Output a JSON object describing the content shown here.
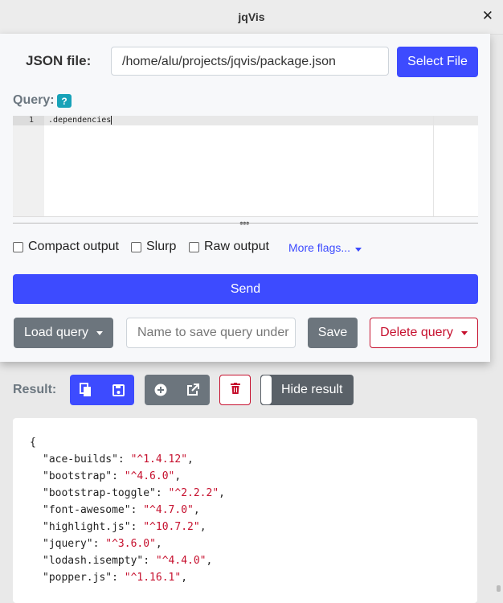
{
  "window": {
    "title": "jqVis"
  },
  "file": {
    "label": "JSON file:",
    "path": "/home/alu/projects/jqvis/package.json",
    "select_label": "Select File"
  },
  "query": {
    "label": "Query:",
    "help": "?",
    "line_number": "1",
    "code": ".dependencies"
  },
  "options": {
    "compact": "Compact output",
    "slurp": "Slurp",
    "raw": "Raw output",
    "more_flags": "More flags..."
  },
  "actions": {
    "send": "Send",
    "load_query": "Load query",
    "name_placeholder": "Name to save query under",
    "save": "Save",
    "delete_query": "Delete query"
  },
  "result": {
    "label": "Result:",
    "toggle_label": "Hide result",
    "open_brace": "{",
    "entries": [
      {
        "key": "\"ace-builds\"",
        "value": "\"^1.4.12\""
      },
      {
        "key": "\"bootstrap\"",
        "value": "\"^4.6.0\""
      },
      {
        "key": "\"bootstrap-toggle\"",
        "value": "\"^2.2.2\""
      },
      {
        "key": "\"font-awesome\"",
        "value": "\"^4.7.0\""
      },
      {
        "key": "\"highlight.js\"",
        "value": "\"^10.7.2\""
      },
      {
        "key": "\"jquery\"",
        "value": "\"^3.6.0\""
      },
      {
        "key": "\"lodash.isempty\"",
        "value": "\"^4.4.0\""
      },
      {
        "key": "\"popper.js\"",
        "value": "\"^1.16.1\""
      }
    ]
  },
  "icons": {
    "close": "close-icon",
    "copy": "copy-icon",
    "save": "floppy-icon",
    "add": "plus-circle-icon",
    "external": "external-link-icon",
    "trash": "trash-icon"
  },
  "colors": {
    "primary": "#3d4bff",
    "secondary": "#6c757d",
    "danger": "#c6102e",
    "info": "#17a2b8"
  }
}
